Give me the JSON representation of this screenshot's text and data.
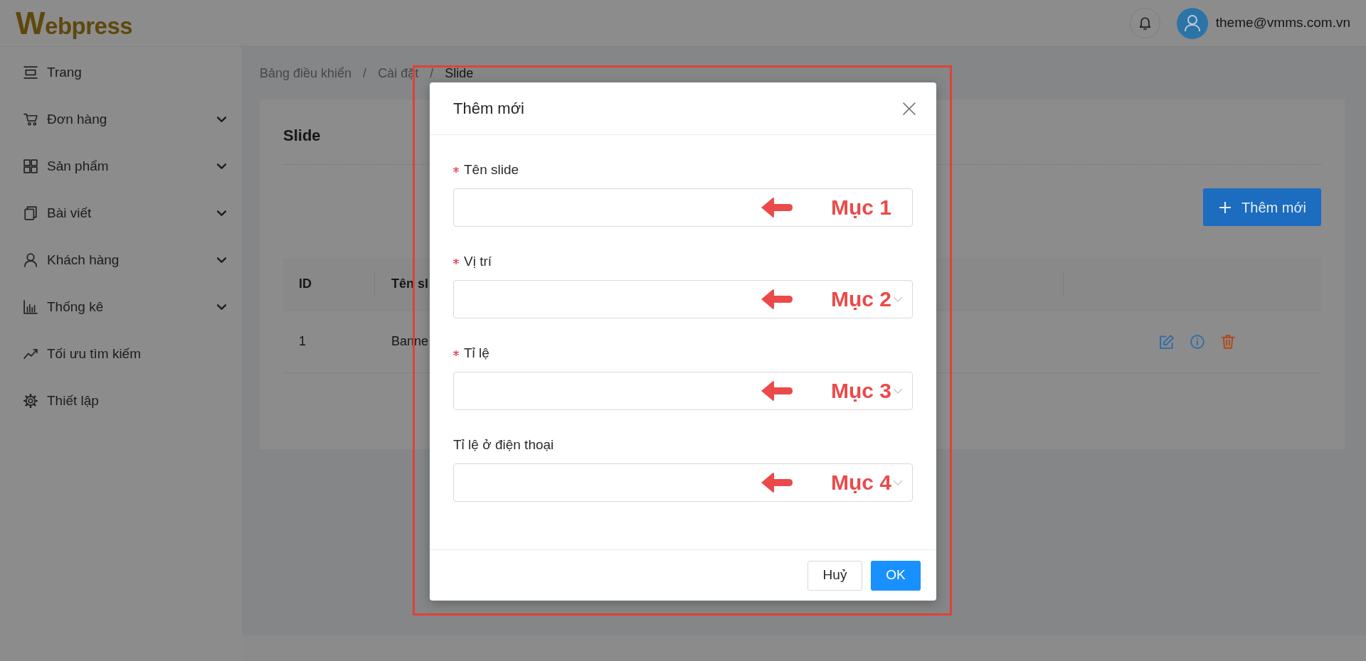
{
  "header": {
    "logo": "Webpress",
    "user": {
      "email": "theme@vmms.com.vn"
    }
  },
  "sidebar": {
    "items": [
      {
        "label": "Trang",
        "kind": "link"
      },
      {
        "label": "Đơn hàng",
        "kind": "submenu"
      },
      {
        "label": "Sản phẩm",
        "kind": "submenu"
      },
      {
        "label": "Bài viết",
        "kind": "submenu"
      },
      {
        "label": "Khách hàng",
        "kind": "submenu"
      },
      {
        "label": "Thống kê",
        "kind": "submenu"
      },
      {
        "label": "Tối ưu tìm kiếm",
        "kind": "link"
      },
      {
        "label": "Thiết lập",
        "kind": "link"
      }
    ]
  },
  "breadcrumb": {
    "items": [
      {
        "label": "Bảng điều khiển",
        "current": false
      },
      {
        "label": "Cài đặt",
        "current": false
      },
      {
        "label": "Slide",
        "current": true
      }
    ],
    "separators": [
      "/",
      "/"
    ]
  },
  "page": {
    "title": "Slide",
    "add_button": {
      "label": "Thêm mới"
    },
    "table": {
      "columns": [
        "ID",
        "Tên sl"
      ],
      "rows": [
        {
          "cells": [
            "1",
            "Banne"
          ]
        }
      ]
    }
  },
  "modal": {
    "title": "Thêm mới",
    "fields": [
      {
        "label": "Tên slide",
        "required": true,
        "kind": "text",
        "annotation": "Mục 1"
      },
      {
        "label": "Vị trí",
        "required": true,
        "kind": "select",
        "annotation": "Mục 2"
      },
      {
        "label": "Tỉ lệ",
        "required": true,
        "kind": "select",
        "annotation": "Mục 3"
      },
      {
        "label": "Tỉ lệ ở điện thoại",
        "required": false,
        "kind": "select",
        "annotation": "Mục 4"
      }
    ],
    "buttons": [
      {
        "label": "Huỷ",
        "kind": "default"
      },
      {
        "label": "OK",
        "kind": "primary"
      }
    ]
  }
}
